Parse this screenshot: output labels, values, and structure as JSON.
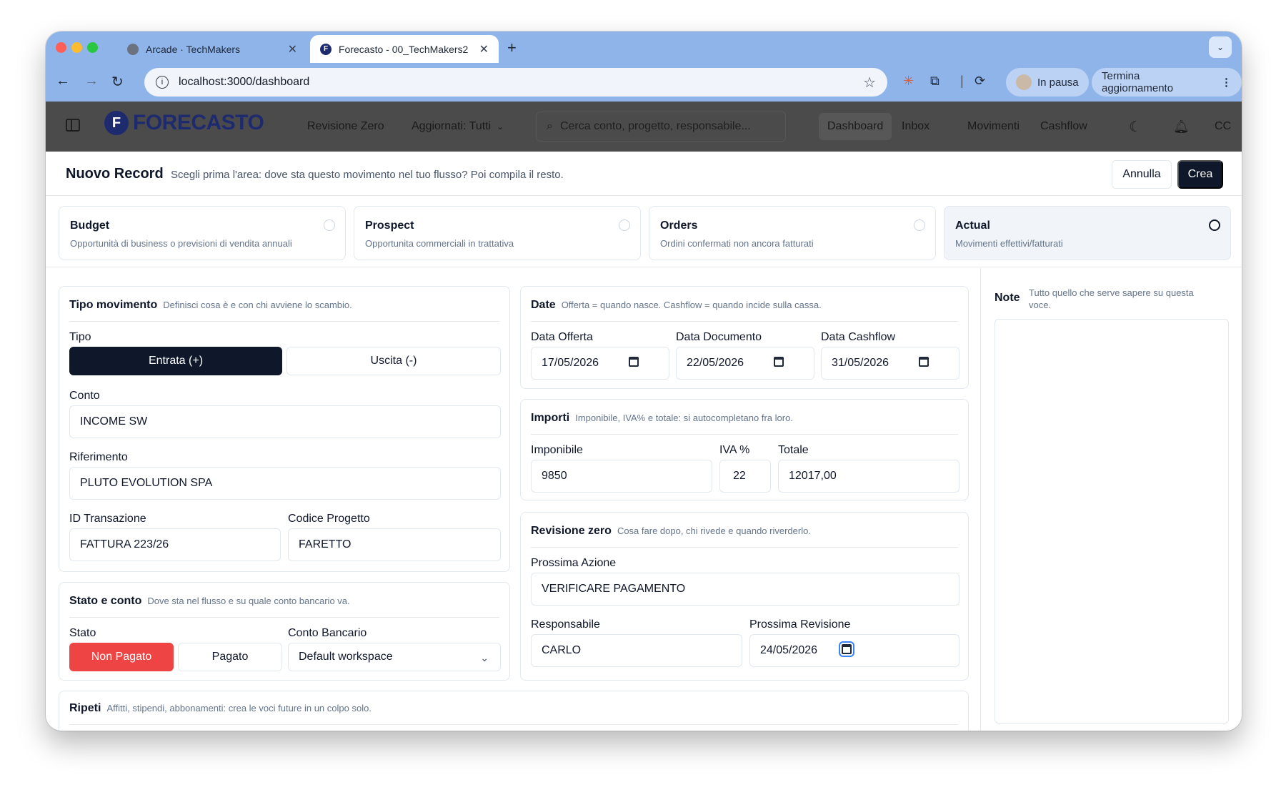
{
  "browser": {
    "tabs": [
      {
        "title": "Arcade · TechMakers",
        "active": false
      },
      {
        "title": "Forecasto - 00_TechMakers2",
        "active": true
      }
    ],
    "url": "localhost:3000/dashboard",
    "profile_label": "In pausa",
    "update_label": "Termina aggiornamento"
  },
  "app": {
    "logo_text": "FORECASTO",
    "nav": {
      "revisione_zero": "Revisione Zero",
      "aggiornati": "Aggiornati: Tutti",
      "search_placeholder": "Cerca conto, progetto, responsabile...",
      "dashboard": "Dashboard",
      "inbox": "Inbox",
      "movimenti": "Movimenti",
      "cashflow": "Cashflow",
      "user_initials": "CC"
    }
  },
  "page": {
    "title": "Nuovo Record",
    "subtitle": "Scegli prima l'area: dove sta questo movimento nel tuo flusso? Poi compila il resto.",
    "cancel_label": "Annulla",
    "create_label": "Crea"
  },
  "areas": [
    {
      "name": "Budget",
      "desc": "Opportunità di business o previsioni di vendita annuali",
      "selected": false
    },
    {
      "name": "Prospect",
      "desc": "Opportunita commerciali in trattativa",
      "selected": false
    },
    {
      "name": "Orders",
      "desc": "Ordini confermati non ancora fatturati",
      "selected": false
    },
    {
      "name": "Actual",
      "desc": "Movimenti effettivi/fatturati",
      "selected": true
    }
  ],
  "tipo_movimento": {
    "title": "Tipo movimento",
    "subtitle": "Definisci cosa è e con chi avviene lo scambio.",
    "tipo_label": "Tipo",
    "entrata": "Entrata (+)",
    "uscita": "Uscita (-)",
    "conto_label": "Conto",
    "conto_value": "INCOME SW",
    "riferimento_label": "Riferimento",
    "riferimento_value": "PLUTO EVOLUTION SPA",
    "id_label": "ID Transazione",
    "id_value": "FATTURA 223/26",
    "codice_label": "Codice Progetto",
    "codice_value": "FARETTO"
  },
  "stato_conto": {
    "title": "Stato e conto",
    "subtitle": "Dove sta nel flusso e su quale conto bancario va.",
    "stato_label": "Stato",
    "non_pagato": "Non Pagato",
    "pagato": "Pagato",
    "conto_bancario_label": "Conto Bancario",
    "conto_bancario_value": "Default workspace"
  },
  "ripeti": {
    "title": "Ripeti",
    "subtitle": "Affitti, stipendi, abbonamenti: crea le voci future in un colpo solo."
  },
  "date": {
    "title": "Date",
    "subtitle": "Offerta = quando nasce. Cashflow = quando incide sulla cassa.",
    "offerta_label": "Data Offerta",
    "offerta_value": "17/05/2026",
    "documento_label": "Data Documento",
    "documento_value": "22/05/2026",
    "cashflow_label": "Data Cashflow",
    "cashflow_value": "31/05/2026"
  },
  "importi": {
    "title": "Importi",
    "subtitle": "Imponibile, IVA% e totale: si autocompletano fra loro.",
    "imponibile_label": "Imponibile",
    "imponibile_value": "9850",
    "iva_label": "IVA %",
    "iva_value": "22",
    "totale_label": "Totale",
    "totale_value": "12017,00"
  },
  "revisione": {
    "title": "Revisione zero",
    "subtitle": "Cosa fare dopo, chi rivede e quando riverderlo.",
    "azione_label": "Prossima Azione",
    "azione_value": "VERIFICARE PAGAMENTO",
    "responsabile_label": "Responsabile",
    "responsabile_value": "CARLO",
    "revisione_label": "Prossima Revisione",
    "revisione_value": "24/05/2026"
  },
  "note": {
    "label": "Note",
    "subtitle": "Tutto quello che serve sapere su questa voce."
  },
  "colors": {
    "primary": "#0f172a",
    "danger": "#ef4444",
    "chrome": "#8fb4ea",
    "appbar": "#4b4b4b"
  }
}
